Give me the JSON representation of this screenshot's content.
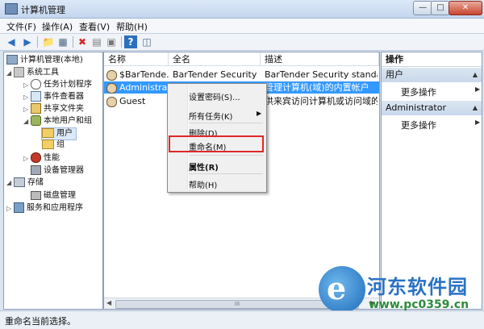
{
  "window": {
    "title": "计算机管理"
  },
  "menu": [
    "文件(F)",
    "操作(A)",
    "查看(V)",
    "帮助(H)"
  ],
  "toolbar": {
    "icons": [
      "back-icon",
      "forward-icon",
      "up-folder-icon",
      "show-hide-tree-icon",
      "delete-icon",
      "properties-icon",
      "export-icon",
      "help-icon",
      "show-action-pane-icon"
    ]
  },
  "tree": {
    "root": "计算机管理(本地)",
    "system_tools": "系统工具",
    "task_scheduler": "任务计划程序",
    "event_viewer": "事件查看器",
    "shared_folders": "共享文件夹",
    "local_users_groups": "本地用户和组",
    "users": "用户",
    "groups": "组",
    "performance": "性能",
    "device_manager": "设备管理器",
    "storage": "存储",
    "disk_management": "磁盘管理",
    "services_apps": "服务和应用程序"
  },
  "list": {
    "columns": [
      "名称",
      "全名",
      "描述"
    ],
    "rows": [
      {
        "name": "$BarTende...",
        "fullname": "BarTender Security Us...",
        "desc": "BarTender Security standard u..."
      },
      {
        "name": "Administrat...",
        "fullname": "",
        "desc": "管理计算机(域)的内置帐户"
      },
      {
        "name": "Guest",
        "fullname": "",
        "desc": "供来宾访问计算机或访问域的内..."
      }
    ],
    "scroll_label": "III"
  },
  "context_menu": {
    "set_password": "设置密码(S)...",
    "all_tasks": "所有任务(K)",
    "delete": "删除(D)",
    "rename": "重命名(M)",
    "properties": "属性(R)",
    "help": "帮助(H)"
  },
  "actions": {
    "title": "操作",
    "section1": "用户",
    "section1_item": "更多操作",
    "section2": "Administrator",
    "section2_item": "更多操作"
  },
  "status": {
    "text": "重命名当前选择。"
  },
  "watermark": {
    "logo_char": "e",
    "name": "河东软件园",
    "url": "www.pc0359.cn"
  },
  "colors": {
    "selection": "#3399ff",
    "highlight_box": "#e0282a",
    "watermark_blue": "#2a72c4",
    "watermark_green": "#2c8a3a"
  }
}
